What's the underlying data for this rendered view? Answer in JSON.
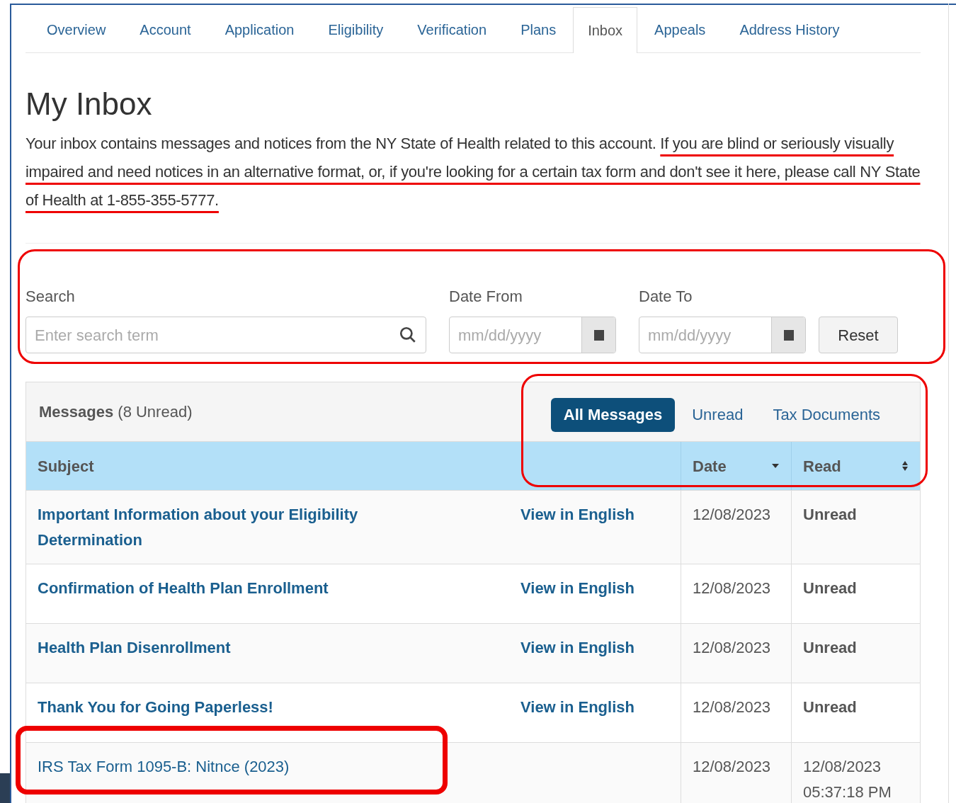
{
  "tabs": [
    {
      "label": "Overview",
      "selected": false
    },
    {
      "label": "Account",
      "selected": false
    },
    {
      "label": "Application",
      "selected": false
    },
    {
      "label": "Eligibility",
      "selected": false
    },
    {
      "label": "Verification",
      "selected": false
    },
    {
      "label": "Plans",
      "selected": false
    },
    {
      "label": "Inbox",
      "selected": true
    },
    {
      "label": "Appeals",
      "selected": false
    },
    {
      "label": "Address History",
      "selected": false
    }
  ],
  "title": "My Inbox",
  "intro": "Your inbox contains messages and notices from the NY State of Health related to this account.",
  "notice": "If you are blind or seriously visually impaired and need notices in an alternative format, or, if you're looking for a certain tax form and don't see it here, please call NY State of Health at 1-855-355-5777.",
  "search": {
    "label": "Search",
    "placeholder": "Enter search term"
  },
  "date_from": {
    "label": "Date From",
    "placeholder": "mm/dd/yyyy"
  },
  "date_to": {
    "label": "Date To",
    "placeholder": "mm/dd/yyyy"
  },
  "reset_button": "Reset",
  "messages": {
    "title": "Messages",
    "count": "(8 Unread)"
  },
  "filters": [
    {
      "label": "All Messages",
      "selected": true
    },
    {
      "label": "Unread",
      "selected": false
    },
    {
      "label": "Tax Documents",
      "selected": false
    }
  ],
  "columns": [
    {
      "label": "Subject",
      "sortable": false
    },
    {
      "label": "Date",
      "sortable": true,
      "sorted": true
    },
    {
      "label": "Read",
      "sortable": true,
      "sorted": false
    }
  ],
  "rows": [
    {
      "subject": "Important Information about your Eligibility Determination",
      "link": "View in English",
      "date": "12/08/2023",
      "read": "Unread",
      "unread": true
    },
    {
      "subject": "Confirmation of Health Plan Enrollment",
      "link": "View in English",
      "date": "12/08/2023",
      "read": "Unread",
      "unread": true
    },
    {
      "subject": "Health Plan Disenrollment",
      "link": "View in English",
      "date": "12/08/2023",
      "read": "Unread",
      "unread": true
    },
    {
      "subject": "Thank You for Going Paperless!",
      "link": "View in English",
      "date": "12/08/2023",
      "read": "Unread",
      "unread": true
    },
    {
      "subject": "IRS Tax Form 1095-B: Nitnce (2023)",
      "date": "12/08/2023",
      "read": "12/08/2023 05:37:18 PM",
      "unread": false
    }
  ]
}
